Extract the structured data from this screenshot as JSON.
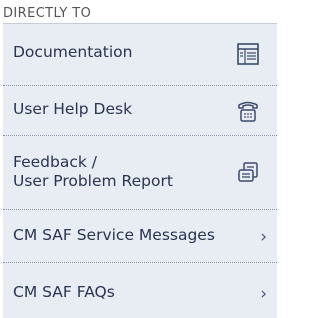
{
  "section": {
    "header": "DIRECTLY TO"
  },
  "items": [
    {
      "label": "Documentation",
      "icon": "document-list-icon"
    },
    {
      "label": "User Help Desk",
      "icon": "phone-icon"
    },
    {
      "label_line1": "Feedback /",
      "label_line2": "User Problem Report",
      "icon": "feedback-phone-icon"
    },
    {
      "label": "CM SAF Service Messages",
      "icon": "chevron-right-icon",
      "chevron": "›"
    },
    {
      "label": "CM SAF FAQs",
      "icon": "chevron-right-icon",
      "chevron": "›"
    }
  ],
  "colors": {
    "panel_background": "#e8ecf3",
    "text": "#2a3550",
    "divider": "#8a94a6",
    "icon": "#3c4b6c"
  }
}
